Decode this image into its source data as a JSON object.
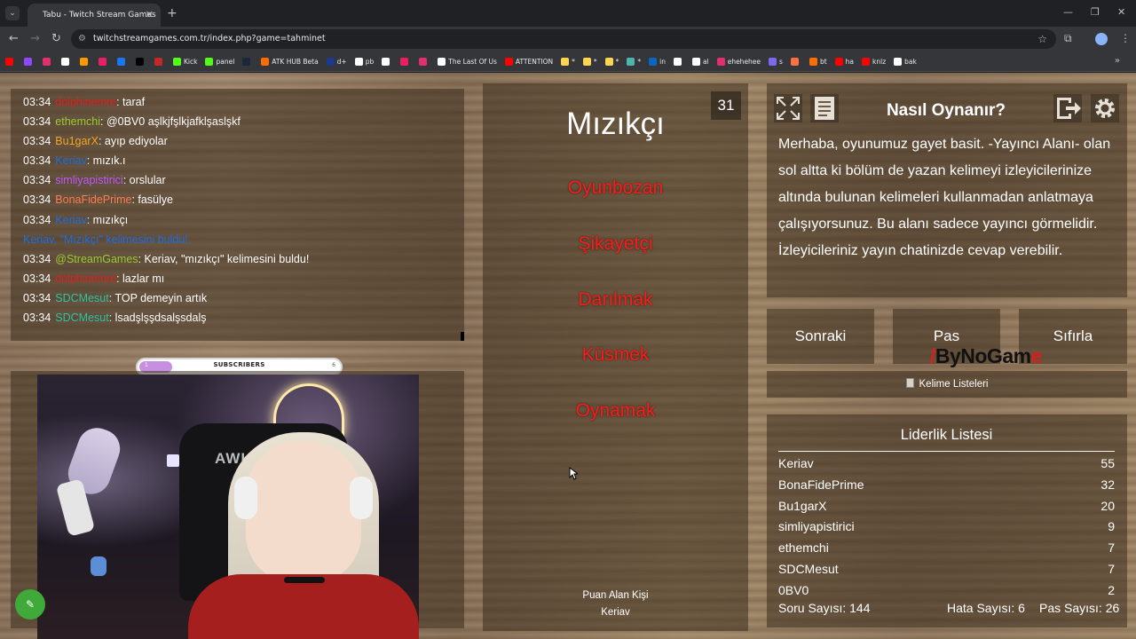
{
  "browser": {
    "tab_title": "Tabu - Twitch Stream Games",
    "url": "twitchstreamgames.com.tr/index.php?game=tahminet",
    "bookmarks": [
      {
        "label": "",
        "color": "#ff0000"
      },
      {
        "label": "",
        "color": "#9146ff"
      },
      {
        "label": "",
        "color": "#e1306c"
      },
      {
        "label": "",
        "color": "#ffffff"
      },
      {
        "label": "",
        "color": "#ff9900"
      },
      {
        "label": "",
        "color": "#e91e63"
      },
      {
        "label": "",
        "color": "#1877f2"
      },
      {
        "label": "",
        "color": "#000000"
      },
      {
        "label": "",
        "color": "#c62828"
      },
      {
        "label": "Kick",
        "color": "#53fc18"
      },
      {
        "label": "panel",
        "color": "#53fc18"
      },
      {
        "label": "",
        "color": "#1b2838"
      },
      {
        "label": "ATK HUB Beta",
        "color": "#ff6d00"
      },
      {
        "label": "d+",
        "color": "#1a3a8f"
      },
      {
        "label": "pb",
        "color": "#ffffff"
      },
      {
        "label": "",
        "color": "#ffffff"
      },
      {
        "label": "",
        "color": "#e91e63"
      },
      {
        "label": "",
        "color": "#e1306c"
      },
      {
        "label": "The Last Of Us",
        "color": "#ffffff"
      },
      {
        "label": "ATTENTION",
        "color": "#ff0000"
      },
      {
        "label": "*",
        "color": "#ffd54f"
      },
      {
        "label": "*",
        "color": "#ffd54f"
      },
      {
        "label": "*",
        "color": "#ffd54f"
      },
      {
        "label": "*",
        "color": "#4db6ac"
      },
      {
        "label": "in",
        "color": "#0a66c2"
      },
      {
        "label": "",
        "color": "#ffffff"
      },
      {
        "label": "al",
        "color": "#ffffff"
      },
      {
        "label": "ehehehee",
        "color": "#e1306c"
      },
      {
        "label": "s",
        "color": "#7b68ee"
      },
      {
        "label": "",
        "color": "#ff7043"
      },
      {
        "label": "bt",
        "color": "#ff6d00"
      },
      {
        "label": "ha",
        "color": "#ff0000"
      },
      {
        "label": "knlz",
        "color": "#ff0000"
      },
      {
        "label": "bak",
        "color": "#ffffff"
      }
    ]
  },
  "chat": [
    {
      "time": "03:34",
      "user": "dolphinemre",
      "color": "#e02020",
      "msg": ": taraf"
    },
    {
      "time": "03:34",
      "user": "ethemchi",
      "color": "#9acd32",
      "msg": ": @0BV0 aşlkjfşlkjafklşaslşkf"
    },
    {
      "time": "03:34",
      "user": "Bu1garX",
      "color": "#f5a623",
      "msg": ": ayıp ediyolar"
    },
    {
      "time": "03:34",
      "user": "Keriav",
      "color": "#1e6fe0",
      "msg": ": mızık.ı"
    },
    {
      "time": "03:34",
      "user": "simliyapistirici",
      "color": "#c45bff",
      "msg": ": orslular"
    },
    {
      "time": "03:34",
      "user": "BonaFidePrime",
      "color": "#ff7f50",
      "msg": ": fasülye"
    },
    {
      "time": "03:34",
      "user": "Keriav",
      "color": "#1e6fe0",
      "msg": ": mızıkçı"
    },
    {
      "time": "",
      "user": "Keriav, \"Mızıkçı\" kelimesini buldu!.",
      "color": "#1e6fe0",
      "msg": ""
    },
    {
      "time": "03:34",
      "user": "@StreamGames",
      "color": "#9acd32",
      "msg": ": Keriav, \"mızıkçı\" kelimesini buldu!"
    },
    {
      "time": "03:34",
      "user": "dolphinemre",
      "color": "#e02020",
      "msg": ": lazlar mı"
    },
    {
      "time": "03:34",
      "user": "SDCMesut",
      "color": "#2ec4a0",
      "msg": ": TOP demeyin artık"
    },
    {
      "time": "03:34",
      "user": "SDCMesut",
      "color": "#2ec4a0",
      "msg": ": lsadşlşşdsalşsdalş"
    }
  ],
  "subscribers": {
    "label": "SUBSCRIBERS",
    "start": "1",
    "end": "6",
    "progress": 0.16
  },
  "card": {
    "timer": "31",
    "word": "Mızıkçı",
    "taboo": [
      "Oyunbozan",
      "Şikayetçi",
      "Darılmak",
      "Küsmek",
      "Oynamak"
    ],
    "scorer_label": "Puan Alan Kişi",
    "scorer_name": "Keriav"
  },
  "howto": {
    "title": "Nasıl Oynanır?",
    "text": "Merhaba, oyunumuz gayet basit. -Yayıncı Alanı- olan sol altta ki bölüm de yazan kelimeyi izleyicilerinize altında bulunan kelimeleri kullanmadan anlatmaya çalışıyorsunuz. Bu alanı sadece yayıncı görmelidir. İzleyicileriniz yayın chatinizde cevap verebilir."
  },
  "buttons": {
    "next": "Sonraki",
    "pass": "Pas",
    "reset": "Sıfırla",
    "word_lists": "Kelime Listeleri"
  },
  "logo": {
    "part1": "ByNoGam",
    "part2": "e"
  },
  "leaderboard": {
    "title": "Liderlik Listesi",
    "rows": [
      {
        "name": "Keriav",
        "score": "55"
      },
      {
        "name": "BonaFidePrime",
        "score": "32"
      },
      {
        "name": "Bu1garX",
        "score": "20"
      },
      {
        "name": "simliyapistirici",
        "score": "9"
      },
      {
        "name": "ethemchi",
        "score": "7"
      },
      {
        "name": "SDCMesut",
        "score": "7"
      },
      {
        "name": "0BV0",
        "score": "2"
      }
    ]
  },
  "stats": {
    "questions": "Soru Sayısı: 144",
    "errors": "Hata Sayısı: 6",
    "passes": "Pas Sayısı: 26"
  }
}
